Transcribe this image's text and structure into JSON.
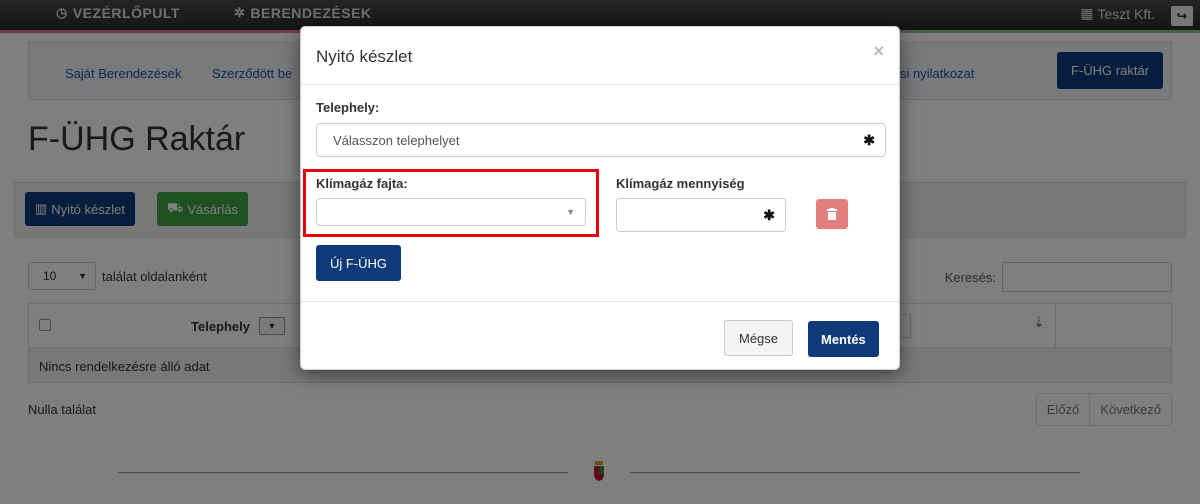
{
  "topnav": {
    "dashboard_icon": "clock-icon",
    "dashboard_label": "VEZÉRLŐPULT",
    "devices_icon": "gear-icon",
    "devices_label": "BERENDEZÉSEK",
    "user_icon": "building-icon",
    "user_name": "Teszt Kft.",
    "logout_icon": "logout-icon"
  },
  "subnav": {
    "items": [
      {
        "label": "Saját Berendezések"
      },
      {
        "label": "Szerződött be"
      },
      {
        "label": "si nyilatkozat"
      }
    ],
    "active_label": "F-ÜHG raktár"
  },
  "page": {
    "title": "F-ÜHG Raktár",
    "open_stock_button": "Nyitó készlet",
    "purchase_button": "Vásárlás",
    "length_value": "10",
    "length_suffix": "találat oldalanként",
    "search_label": "Keresés:",
    "table": {
      "header_site": "Telephely",
      "empty_message": "Nincs rendelkezésre álló adat"
    },
    "result_count": "Nulla találat",
    "prev_label": "Előző",
    "next_label": "Következő"
  },
  "modal": {
    "title": "Nyitó készlet",
    "close_symbol": "×",
    "site_label": "Telephely:",
    "site_placeholder": "Válasszon telephelyet",
    "gas_type_label": "Klímagáz fajta:",
    "gas_type_value": "",
    "gas_qty_label": "Klímagáz mennyiség",
    "gas_qty_value": "",
    "required_symbol": "✱",
    "new_button": "Új F-ÜHG",
    "cancel_button": "Mégse",
    "save_button": "Mentés"
  },
  "colors": {
    "primary": "#0f3a7a",
    "success": "#3fa043",
    "danger": "#d9534f",
    "highlight": "#e8000b"
  }
}
